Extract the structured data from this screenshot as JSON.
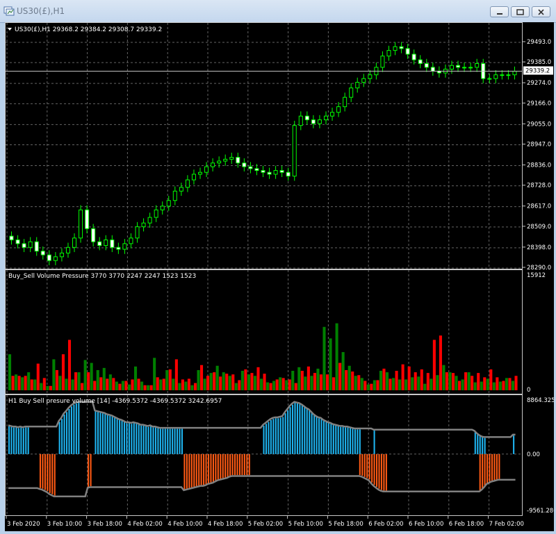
{
  "window": {
    "title": "US30(£),H1"
  },
  "price_pane": {
    "header": "US30(£),H1  29368.2 29384.2 29308.7 29339.2",
    "current_price_label": "29339.2",
    "y_ticks": [
      "29493.0",
      "29385.0",
      "29274.0",
      "29166.0",
      "29055.0",
      "28947.0",
      "28836.0",
      "28728.0",
      "28617.0",
      "28509.0",
      "28398.0",
      "28290.0"
    ],
    "ylim": [
      28290.0,
      29493.0
    ]
  },
  "volume_pane": {
    "header": "Buy_Sell Volume Pressure 3770 3770 2247 2247 1523 1523",
    "y_max_label": "15912",
    "y_min_label": "0"
  },
  "pressure_pane": {
    "header": "H1 Buy Sell presure volume [14] -4369.5372 -4369.5372 3242.6957",
    "y_max_label": "8864.3251",
    "y_zero_label": "0.00",
    "y_min_label": "-9561.280"
  },
  "x_axis": {
    "labels": [
      "3 Feb 2020",
      "3 Feb 10:00",
      "3 Feb 18:00",
      "4 Feb 02:00",
      "4 Feb 10:00",
      "4 Feb 18:00",
      "5 Feb 02:00",
      "5 Feb 10:00",
      "5 Feb 18:00",
      "6 Feb 02:00",
      "6 Feb 10:00",
      "6 Feb 18:00",
      "7 Feb 02:00"
    ]
  },
  "colors": {
    "bull_candle": "#00ff00",
    "bear_candle": "#ffffff",
    "buy_volume": "#008000",
    "sell_volume": "#ff0000",
    "buy_pressure": "#1eb4f0",
    "sell_pressure": "#ff5a14",
    "envelope": "#808080",
    "grid": "#646464"
  },
  "chart_data": [
    {
      "type": "candlestick",
      "title": "US30(£),H1",
      "ylim": [
        28290.0,
        29493.0
      ],
      "close": [
        28440,
        28420,
        28400,
        28430,
        28380,
        28360,
        28330,
        28350,
        28370,
        28400,
        28450,
        28600,
        28500,
        28430,
        28410,
        28440,
        28400,
        28390,
        28420,
        28450,
        28510,
        28530,
        28560,
        28600,
        28620,
        28650,
        28700,
        28720,
        28760,
        28790,
        28800,
        28830,
        28850,
        28860,
        28870,
        28880,
        28850,
        28830,
        28820,
        28810,
        28800,
        28790,
        28810,
        28800,
        28780,
        29050,
        29100,
        29080,
        29060,
        29080,
        29100,
        29120,
        29150,
        29200,
        29250,
        29280,
        29300,
        29320,
        29360,
        29420,
        29450,
        29470,
        29460,
        29430,
        29400,
        29380,
        29360,
        29340,
        29330,
        29350,
        29370,
        29360,
        29360,
        29360,
        29380,
        29300,
        29300,
        29320,
        29320,
        29320,
        29339
      ]
    },
    {
      "type": "bar",
      "title": "Buy_Sell Volume Pressure",
      "ylim": [
        0,
        15912
      ],
      "buy_values": [
        5000,
        2200,
        1800,
        2500,
        1500,
        1000,
        600,
        4300,
        2000,
        1600,
        1500,
        2500,
        4200,
        3800,
        2800,
        3100,
        2200,
        1200,
        1300,
        800,
        3300,
        1200,
        700,
        4500,
        1500,
        2800,
        1600,
        1000,
        1200,
        700,
        2800,
        1600,
        2400,
        3400,
        2500,
        2000,
        1000,
        2700,
        2200,
        2000,
        1600,
        1100,
        1300,
        1800,
        1400,
        2700,
        3200,
        1900,
        2000,
        3000,
        8800,
        7200,
        9300,
        5300,
        3400,
        2000,
        1700,
        800,
        1400,
        2700,
        2500,
        1700,
        1500,
        1500,
        1800,
        1900,
        900,
        1600,
        2100,
        3500,
        2500,
        2000,
        1500,
        2500,
        1100,
        1200,
        1600,
        1100,
        1200,
        1700,
        1300
      ],
      "sell_values": [
        2000,
        2000,
        2000,
        1500,
        3700,
        1700,
        600,
        2800,
        5000,
        7000,
        2500,
        1000,
        2500,
        1300,
        1800,
        1600,
        1700,
        900,
        1300,
        1500,
        1600,
        700,
        700,
        1800,
        1600,
        2900,
        4300,
        1500,
        1600,
        1000,
        3500,
        2000,
        2500,
        1900,
        2300,
        2200,
        1400,
        2900,
        2400,
        3200,
        2300,
        1000,
        1500,
        1700,
        1500,
        1000,
        2700,
        3300,
        2400,
        2200,
        2200,
        1800,
        3800,
        2800,
        2600,
        2100,
        1300,
        900,
        1400,
        3000,
        1600,
        2700,
        3600,
        3300,
        2500,
        2900,
        2400,
        7000,
        7600,
        2500,
        2400,
        1300,
        2500,
        2000,
        2400,
        1800,
        2900,
        1800,
        1300,
        1700,
        2000
      ]
    },
    {
      "type": "bar",
      "title": "H1 Buy Sell presure volume [14]",
      "ylim": [
        -9561.28,
        8864.3251
      ],
      "buy_values": [
        4500,
        4400,
        4300,
        4300,
        4200,
        4300,
        4200,
        4300,
        4300,
        0,
        0,
        0,
        0,
        0,
        0,
        0,
        0,
        0,
        0,
        0,
        0,
        5200,
        5700,
        6400,
        6800,
        7300,
        7700,
        8000,
        8200,
        8300,
        0,
        0,
        0,
        0,
        0,
        0,
        6900,
        6800,
        6700,
        6600,
        6500,
        6300,
        6200,
        6100,
        5900,
        5700,
        5500,
        5400,
        5200,
        5000,
        5000,
        4900,
        5000,
        4900,
        4800,
        4600,
        4600,
        4500,
        4400,
        4500,
        4300,
        4300,
        4200,
        4100,
        4100,
        4100,
        4100,
        4100,
        4100,
        4100,
        4100,
        4100,
        4100,
        0,
        0,
        0,
        0,
        0,
        0,
        0,
        0,
        0,
        0,
        0,
        0,
        0,
        0,
        0,
        0,
        0,
        0,
        0,
        0,
        0,
        0,
        0,
        0,
        0,
        0,
        0,
        0,
        0,
        0,
        0,
        0,
        0,
        4600,
        4900,
        5200,
        5500,
        5700,
        5800,
        5800,
        5900,
        6000,
        6600,
        7100,
        7600,
        8000,
        8300,
        8200,
        8100,
        7900,
        7600,
        7300,
        7100,
        6700,
        6300,
        6000,
        5800,
        5700,
        5400,
        5200,
        5000,
        4900,
        4700,
        4600,
        4500,
        4400,
        4400,
        4300,
        4300,
        4200,
        4100,
        4000,
        4000,
        4000,
        0,
        0,
        0,
        0,
        0,
        3800,
        0,
        0,
        0,
        0,
        0,
        0,
        0,
        0,
        0,
        0,
        0,
        0,
        0,
        0,
        0,
        0,
        0,
        0,
        0,
        0,
        0,
        0,
        0,
        0,
        0,
        0,
        0,
        0,
        0,
        0,
        0,
        0,
        0,
        0,
        0,
        0,
        0,
        0,
        0,
        0,
        0,
        3600,
        3200,
        2900,
        2700,
        2600,
        0,
        0,
        0,
        0,
        0,
        0,
        0,
        0,
        0,
        0,
        0,
        3000,
        0
      ],
      "sell_values": [
        0,
        0,
        0,
        0,
        0,
        0,
        0,
        0,
        0,
        0,
        0,
        0,
        0,
        5500,
        5600,
        5800,
        6000,
        6300,
        6500,
        6700,
        0,
        0,
        0,
        0,
        0,
        0,
        0,
        0,
        0,
        0,
        0,
        0,
        0,
        5300,
        5200,
        0,
        0,
        0,
        0,
        0,
        0,
        0,
        0,
        0,
        0,
        0,
        0,
        0,
        0,
        0,
        0,
        0,
        0,
        0,
        0,
        0,
        0,
        0,
        0,
        0,
        0,
        0,
        0,
        0,
        0,
        0,
        0,
        0,
        0,
        0,
        0,
        0,
        0,
        5700,
        5600,
        5500,
        5400,
        5300,
        5200,
        5100,
        5000,
        5000,
        4900,
        4700,
        4600,
        4500,
        4300,
        4100,
        4000,
        3900,
        3800,
        3700,
        3500,
        3400,
        3400,
        3400,
        3400,
        3400,
        3400,
        3400,
        3400,
        0,
        0,
        0,
        0,
        0,
        0,
        0,
        0,
        0,
        0,
        0,
        0,
        0,
        0,
        0,
        0,
        0,
        0,
        0,
        0,
        0,
        0,
        0,
        0,
        0,
        0,
        0,
        0,
        0,
        0,
        0,
        0,
        0,
        0,
        0,
        0,
        0,
        0,
        0,
        0,
        0,
        0,
        0,
        0,
        0,
        3400,
        3500,
        3700,
        3900,
        4100,
        4600,
        5000,
        5300,
        5600,
        5800,
        5900,
        5900,
        0,
        0,
        0,
        0,
        0,
        0,
        0,
        0,
        0,
        0,
        0,
        0,
        0,
        0,
        0,
        0,
        0,
        0,
        0,
        0,
        0,
        0,
        0,
        0,
        0,
        0,
        0,
        0,
        0,
        0,
        0,
        0,
        0,
        0,
        0,
        0,
        0,
        0,
        5900,
        5600,
        5200,
        4700,
        4500,
        4300,
        4200,
        4100,
        4000,
        0,
        0,
        0,
        0,
        0,
        0,
        0,
        0,
        0,
        0,
        0,
        0,
        0,
        0,
        0,
        0,
        0,
        0,
        0,
        0,
        0,
        0,
        0,
        0,
        0,
        0,
        0,
        0,
        0,
        0,
        0,
        0,
        0,
        0,
        0,
        0,
        0,
        0,
        0,
        0,
        0,
        0,
        0,
        0,
        0,
        0,
        0,
        0,
        0,
        0,
        0,
        0,
        0,
        0,
        0,
        0,
        0,
        0,
        0,
        0,
        0,
        0,
        0,
        0,
        0,
        0,
        0,
        0,
        0,
        0,
        0,
        0,
        0,
        0,
        0,
        0,
        0,
        0,
        0,
        0,
        0,
        0,
        0,
        0,
        0,
        0,
        0
      ]
    }
  ]
}
